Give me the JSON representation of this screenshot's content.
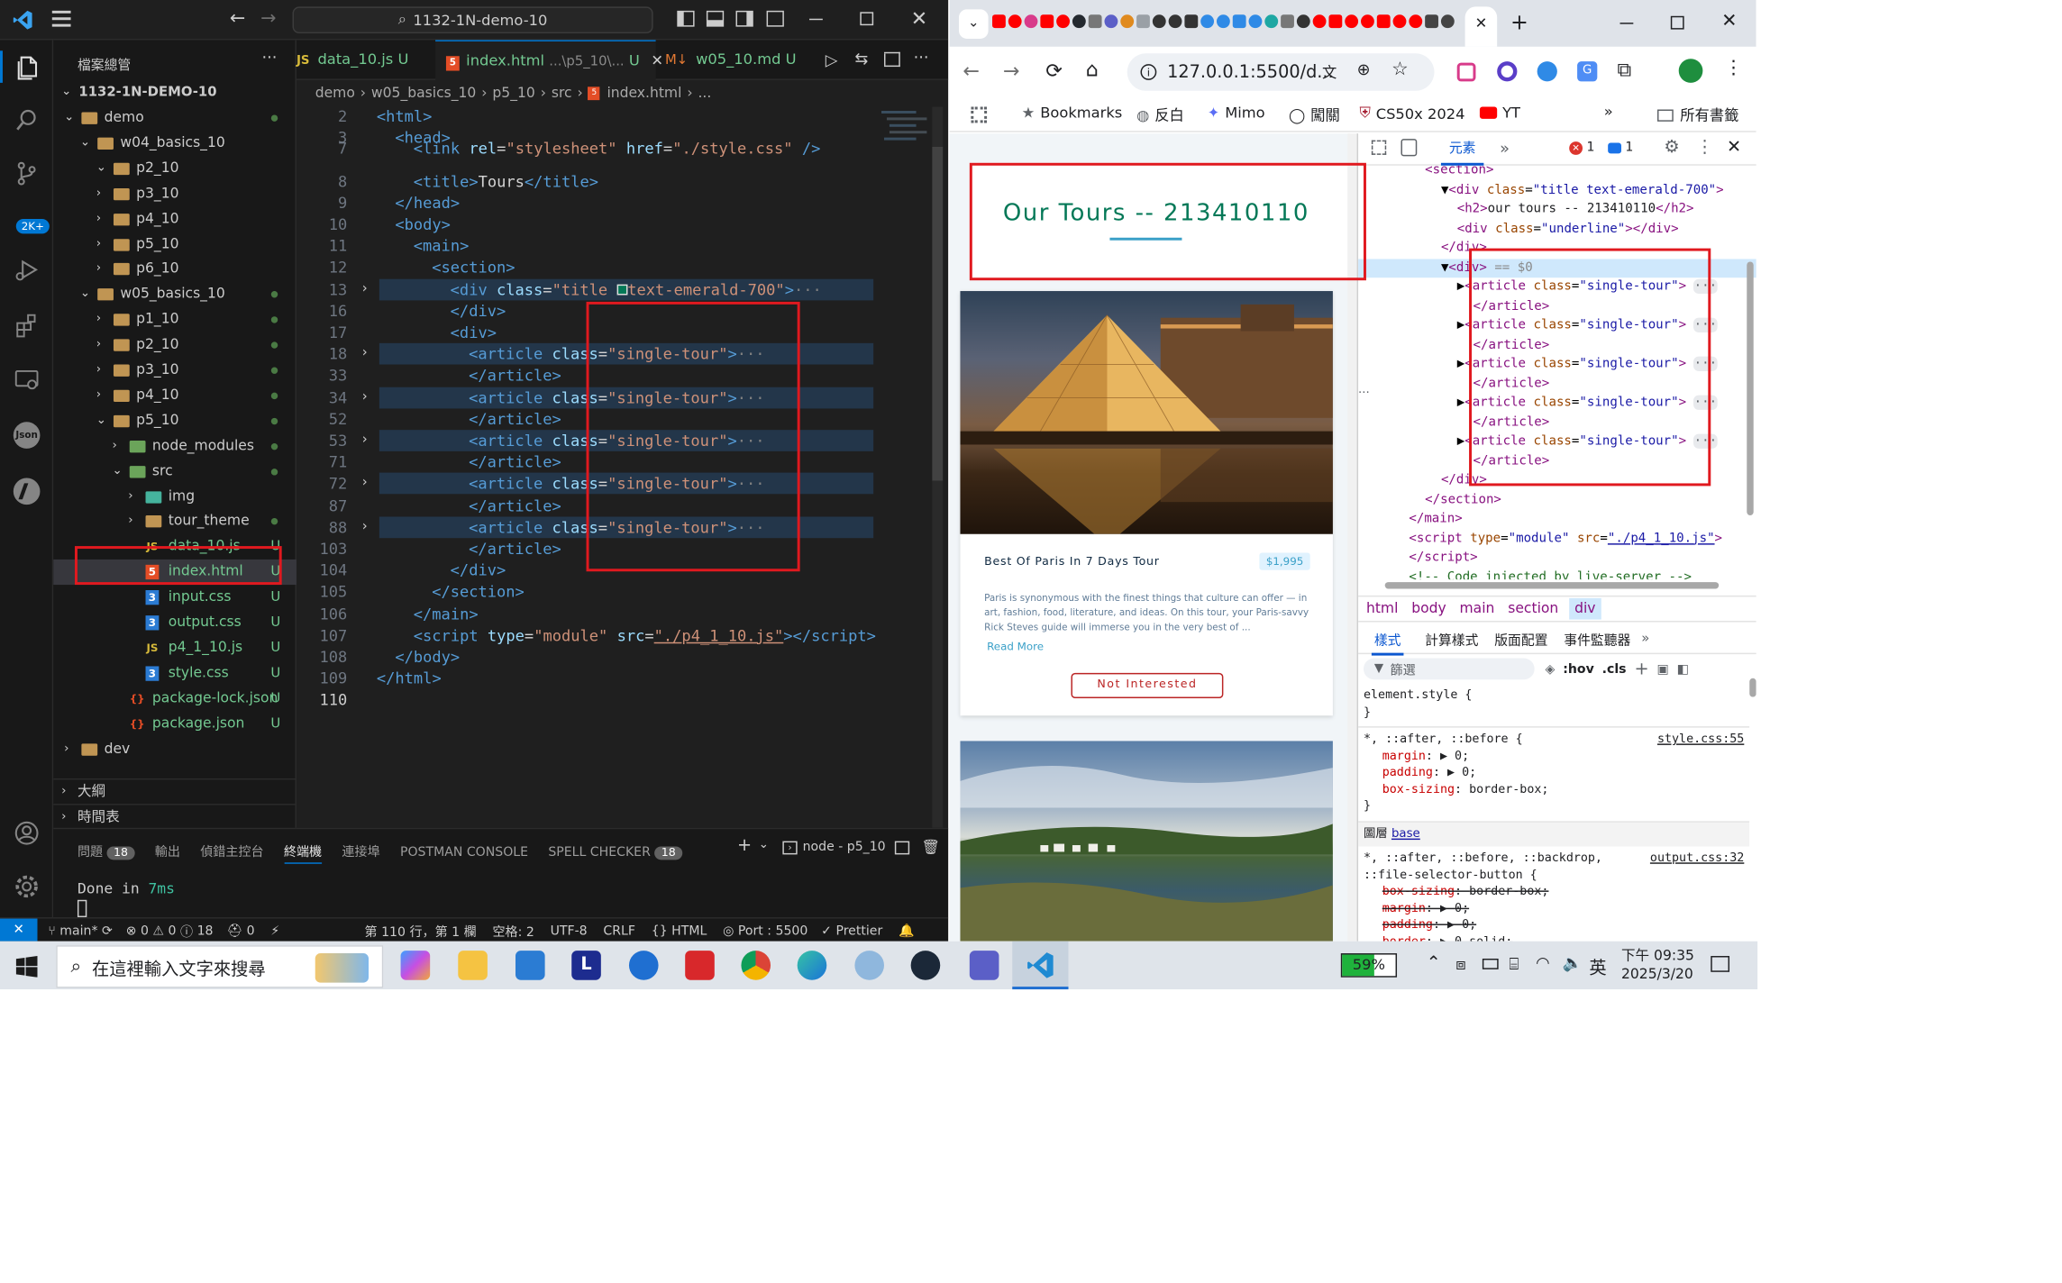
{
  "vscode": {
    "title_search": "1132-1N-demo-10",
    "explorer_title": "檔案總管",
    "root_folder": "1132-1N-DEMO-10",
    "source_control_badge": "2K+",
    "tree": [
      {
        "label": "demo",
        "kind": "folder",
        "open": true,
        "indent": 1,
        "status": "dot"
      },
      {
        "label": "w04_basics_10",
        "kind": "folder",
        "open": true,
        "indent": 2,
        "status": ""
      },
      {
        "label": "p2_10",
        "kind": "folder",
        "open": true,
        "indent": 3,
        "status": ""
      },
      {
        "label": "p3_10",
        "kind": "folder",
        "open": false,
        "indent": 3,
        "status": ""
      },
      {
        "label": "p4_10",
        "kind": "folder",
        "open": false,
        "indent": 3,
        "status": ""
      },
      {
        "label": "p5_10",
        "kind": "folder",
        "open": false,
        "indent": 3,
        "status": ""
      },
      {
        "label": "p6_10",
        "kind": "folder",
        "open": false,
        "indent": 3,
        "status": ""
      },
      {
        "label": "w05_basics_10",
        "kind": "folder",
        "open": true,
        "indent": 2,
        "status": "dot"
      },
      {
        "label": "p1_10",
        "kind": "folder",
        "open": false,
        "indent": 3,
        "status": "dot"
      },
      {
        "label": "p2_10",
        "kind": "folder",
        "open": false,
        "indent": 3,
        "status": "dot"
      },
      {
        "label": "p3_10",
        "kind": "folder",
        "open": false,
        "indent": 3,
        "status": "dot"
      },
      {
        "label": "p4_10",
        "kind": "folder",
        "open": false,
        "indent": 3,
        "status": "dot"
      },
      {
        "label": "p5_10",
        "kind": "folder",
        "open": true,
        "indent": 3,
        "status": "dot"
      },
      {
        "label": "node_modules",
        "kind": "folder-green",
        "open": false,
        "indent": 4,
        "status": "dot"
      },
      {
        "label": "src",
        "kind": "folder-green",
        "open": true,
        "indent": 4,
        "status": "dot"
      },
      {
        "label": "img",
        "kind": "folder-img",
        "open": false,
        "indent": 5,
        "status": ""
      },
      {
        "label": "tour_theme",
        "kind": "folder",
        "open": false,
        "indent": 5,
        "status": "dot"
      },
      {
        "label": "data_10.js",
        "kind": "js",
        "open": false,
        "indent": 5,
        "status": "U"
      },
      {
        "label": "index.html",
        "kind": "html",
        "open": false,
        "indent": 5,
        "status": "U"
      },
      {
        "label": "input.css",
        "kind": "css",
        "open": false,
        "indent": 5,
        "status": "U"
      },
      {
        "label": "output.css",
        "kind": "css",
        "open": false,
        "indent": 5,
        "status": "U"
      },
      {
        "label": "p4_1_10.js",
        "kind": "js",
        "open": false,
        "indent": 5,
        "status": "U"
      },
      {
        "label": "style.css",
        "kind": "css",
        "open": false,
        "indent": 5,
        "status": "U"
      },
      {
        "label": "package-lock.json",
        "kind": "json",
        "open": false,
        "indent": 4,
        "status": "U"
      },
      {
        "label": "package.json",
        "kind": "json",
        "open": false,
        "indent": 4,
        "status": "U"
      },
      {
        "label": "dev",
        "kind": "folder",
        "open": false,
        "indent": 1,
        "status": ""
      }
    ],
    "outline_label": "大綱",
    "timeline_label": "時間表",
    "tabs": [
      {
        "icon": "JS",
        "name": "data_10.js",
        "suffix": "U"
      },
      {
        "icon": "5",
        "name": "index.html",
        "path": "...\\p5_10\\...",
        "suffix": "U",
        "active": true
      },
      {
        "icon": "M",
        "name": "w05_10.md",
        "suffix": "U"
      }
    ],
    "breadcrumb": [
      "demo",
      "w05_basics_10",
      "p5_10",
      "src",
      "index.html",
      "..."
    ],
    "code_lines": [
      {
        "n": "2",
        "html": "<span class='tg'>&lt;html&gt;</span>",
        "ind": 0
      },
      {
        "n": "3",
        "html": "<span class='tg'>&lt;head&gt;</span>",
        "ind": 1
      },
      {
        "n": "7",
        "html": "<span class='tg'>&lt;link</span> <span class='at'>rel</span>=<span class='st'>\"stylesheet\"</span> <span class='at'>href</span>=<span class='st'>\"./style.css\"</span> <span class='tg'>/&gt;</span>",
        "ind": 2
      },
      {
        "n": "8",
        "html": "<span class='tg'>&lt;title&gt;</span>Tours<span class='tg'>&lt;/title&gt;</span>",
        "ind": 2
      },
      {
        "n": "9",
        "html": "<span class='tg'>&lt;/head&gt;</span>",
        "ind": 1
      },
      {
        "n": "10",
        "html": "<span class='tg'>&lt;body&gt;</span>",
        "ind": 1
      },
      {
        "n": "11",
        "html": "<span class='tg'>&lt;main&gt;</span>",
        "ind": 2
      },
      {
        "n": "12",
        "html": "<span class='tg'>&lt;section&gt;</span>",
        "ind": 3
      },
      {
        "n": "13",
        "html": "<span class='tg'>&lt;div</span> <span class='at'>class</span>=<span class='st'>\"title </span><span style='display:inline-block;width:8px;height:8px;background:#047857;border:1px solid #ddd'></span><span class='st'>text-emerald-700\"</span><span class='tg'>&gt;</span><span class='gy'>···</span>",
        "ind": 4,
        "fold": true,
        "hl": true
      },
      {
        "n": "16",
        "html": "<span class='tg'>&lt;/div&gt;</span>",
        "ind": 4
      },
      {
        "n": "17",
        "html": "<span class='tg'>&lt;div&gt;</span>",
        "ind": 4
      },
      {
        "n": "18",
        "html": "<span class='tg'>&lt;article</span> <span class='at'>class</span>=<span class='st'>\"single-tour\"</span><span class='tg'>&gt;</span><span class='gy'>···</span>",
        "ind": 5,
        "fold": true,
        "hl": true
      },
      {
        "n": "33",
        "html": "<span class='tg'>&lt;/article&gt;</span>",
        "ind": 5
      },
      {
        "n": "34",
        "html": "<span class='tg'>&lt;article</span> <span class='at'>class</span>=<span class='st'>\"single-tour\"</span><span class='tg'>&gt;</span><span class='gy'>···</span>",
        "ind": 5,
        "fold": true,
        "hl": true
      },
      {
        "n": "52",
        "html": "<span class='tg'>&lt;/article&gt;</span>",
        "ind": 5
      },
      {
        "n": "53",
        "html": "<span class='tg'>&lt;article</span> <span class='at'>class</span>=<span class='st'>\"single-tour\"</span><span class='tg'>&gt;</span><span class='gy'>···</span>",
        "ind": 5,
        "fold": true,
        "hl": true
      },
      {
        "n": "71",
        "html": "<span class='tg'>&lt;/article&gt;</span>",
        "ind": 5
      },
      {
        "n": "72",
        "html": "<span class='tg'>&lt;article</span> <span class='at'>class</span>=<span class='st'>\"single-tour\"</span><span class='tg'>&gt;</span><span class='gy'>···</span>",
        "ind": 5,
        "fold": true,
        "hl": true
      },
      {
        "n": "87",
        "html": "<span class='tg'>&lt;/article&gt;</span>",
        "ind": 5
      },
      {
        "n": "88",
        "html": "<span class='tg'>&lt;article</span> <span class='at'>class</span>=<span class='st'>\"single-tour\"</span><span class='tg'>&gt;</span><span class='gy'>···</span>",
        "ind": 5,
        "fold": true,
        "hl": true
      },
      {
        "n": "103",
        "html": "<span class='tg'>&lt;/article&gt;</span>",
        "ind": 5
      },
      {
        "n": "104",
        "html": "<span class='tg'>&lt;/div&gt;</span>",
        "ind": 4
      },
      {
        "n": "105",
        "html": "<span class='tg'>&lt;/section&gt;</span>",
        "ind": 3
      },
      {
        "n": "106",
        "html": "<span class='tg'>&lt;/main&gt;</span>",
        "ind": 2
      },
      {
        "n": "107",
        "html": "<span class='tg'>&lt;script</span> <span class='at'>type</span>=<span class='st'>\"module\"</span> <span class='at'>src</span>=<span class='st' style='text-decoration:underline'>\"./p4_1_10.js\"</span><span class='tg'>&gt;&lt;/script&gt;</span>",
        "ind": 2
      },
      {
        "n": "108",
        "html": "<span class='tg'>&lt;/body&gt;</span>",
        "ind": 1
      },
      {
        "n": "109",
        "html": "<span class='tg'>&lt;/html&gt;</span>",
        "ind": 0
      },
      {
        "n": "110",
        "html": "",
        "ind": 0
      }
    ],
    "panel_tabs": [
      {
        "label": "問題",
        "badge": "18"
      },
      {
        "label": "輸出"
      },
      {
        "label": "偵錯主控台"
      },
      {
        "label": "終端機",
        "active": true
      },
      {
        "label": "連接埠"
      },
      {
        "label": "POSTMAN CONSOLE"
      },
      {
        "label": "SPELL CHECKER",
        "badge": "18"
      }
    ],
    "terminal_name": "node - p5_10",
    "terminal_output_prefix": "Done in ",
    "terminal_output_time": "7ms",
    "status": {
      "branch": "main*",
      "errors": "0",
      "warnings": "0",
      "info": "18",
      "ports": "0",
      "position": "第 110 行，第 1 欄",
      "spaces": "空格: 2",
      "encoding": "UTF-8",
      "eol": "CRLF",
      "language": "HTML",
      "port": "Port : 5500",
      "prettier": "Prettier"
    }
  },
  "chrome": {
    "url": "127.0.0.1:5500/d...",
    "bookmarks": [
      "Bookmarks",
      "反白",
      "Mimo",
      "闖關",
      "CS50x 2024",
      "YT"
    ],
    "all_bookmarks": "所有書籤",
    "page": {
      "heading": "Our Tours -- 213410110",
      "card": {
        "name": "Best Of Paris In 7 Days Tour",
        "price": "$1,995",
        "info": "Paris is synonymous with the finest things that culture can offer — in art, fashion, food, literature, and ideas. On this tour, your Paris-savvy Rick Steves guide will immerse you in the very best of ...",
        "read_more": "Read More",
        "button": "Not Interested"
      }
    },
    "devtools": {
      "tab_elements": "元素",
      "errors": "1",
      "messages": "1",
      "dom_lines": [
        {
          "ind": 0,
          "html": "<span class='t'>&lt;section&gt;</span>"
        },
        {
          "ind": 1,
          "html": "▼<span class='t'>&lt;div</span> <span class='a'>class</span>=<span class='v'>\"title text-emerald-700\"</span><span class='t'>&gt;</span>"
        },
        {
          "ind": 2,
          "html": "<span class='t'>&lt;h2&gt;</span><span class='x'>our tours -- 213410110</span><span class='t'>&lt;/h2&gt;</span>"
        },
        {
          "ind": 2,
          "html": "<span class='t'>&lt;div</span> <span class='a'>class</span>=<span class='v'>\"underline\"</span><span class='t'>&gt;&lt;/div&gt;</span>"
        },
        {
          "ind": 1,
          "html": "<span class='t'>&lt;/div&gt;</span>"
        },
        {
          "ind": 1,
          "html": "▼<span class='t'>&lt;div&gt;</span> <span style='color:#888'>== $0</span>",
          "sel": true
        },
        {
          "ind": 2,
          "html": "▶<span class='t'>&lt;article</span> <span class='a'>class</span>=<span class='v'>\"single-tour\"</span><span class='t'>&gt;</span> <span style='background:#e8eaed;color:#5f6368;border-radius:4px'>···</span>"
        },
        {
          "ind": 3,
          "html": "<span class='t'>&lt;/article&gt;</span>"
        },
        {
          "ind": 2,
          "html": "▶<span class='t'>&lt;article</span> <span class='a'>class</span>=<span class='v'>\"single-tour\"</span><span class='t'>&gt;</span> <span style='background:#e8eaed;color:#5f6368;border-radius:4px'>···</span>"
        },
        {
          "ind": 3,
          "html": "<span class='t'>&lt;/article&gt;</span>"
        },
        {
          "ind": 2,
          "html": "▶<span class='t'>&lt;article</span> <span class='a'>class</span>=<span class='v'>\"single-tour\"</span><span class='t'>&gt;</span> <span style='background:#e8eaed;color:#5f6368;border-radius:4px'>···</span>"
        },
        {
          "ind": 3,
          "html": "<span class='t'>&lt;/article&gt;</span>"
        },
        {
          "ind": 2,
          "html": "▶<span class='t'>&lt;article</span> <span class='a'>class</span>=<span class='v'>\"single-tour\"</span><span class='t'>&gt;</span> <span style='background:#e8eaed;color:#5f6368;border-radius:4px'>···</span>"
        },
        {
          "ind": 3,
          "html": "<span class='t'>&lt;/article&gt;</span>"
        },
        {
          "ind": 2,
          "html": "▶<span class='t'>&lt;article</span> <span class='a'>class</span>=<span class='v'>\"single-tour\"</span><span class='t'>&gt;</span> <span style='background:#e8eaed;color:#5f6368;border-radius:4px'>···</span>"
        },
        {
          "ind": 3,
          "html": "<span class='t'>&lt;/article&gt;</span>"
        },
        {
          "ind": 1,
          "html": "<span class='t'>&lt;/div&gt;</span>"
        },
        {
          "ind": 0,
          "html": "<span class='t'>&lt;/section&gt;</span>"
        },
        {
          "ind": -1,
          "html": "<span class='t'>&lt;/main&gt;</span>"
        },
        {
          "ind": -1,
          "html": "<span class='t'>&lt;script</span> <span class='a'>type</span>=<span class='v'>\"module\"</span> <span class='a'>src</span>=<span class='v' style='text-decoration:underline'>\"./p4_1_10.js\"</span><span class='t'>&gt;</span>"
        },
        {
          "ind": -1,
          "html": "<span class='t'>&lt;/script&gt;</span>"
        },
        {
          "ind": -1,
          "html": "<span style='color:#236e25'>&lt;!-- Code injected by live-server --&gt;</span>"
        }
      ],
      "crumbs": [
        "html",
        "body",
        "main",
        "section",
        "div"
      ],
      "style_tabs": [
        "樣式",
        "計算樣式",
        "版面配置",
        "事件監聽器"
      ],
      "filter_placeholder": "篩選",
      "hov": ":hov",
      "cls": ".cls",
      "element_style": "element.style {",
      "rule1_selector": "*, ::after, ::before {",
      "rule1_source": "style.css:55",
      "rule1_props": [
        {
          "name": "margin",
          "value": "0"
        },
        {
          "name": "padding",
          "value": "0"
        },
        {
          "name": "box-sizing",
          "value": "border-box"
        }
      ],
      "layer_label": "圖層",
      "layer_link": "base",
      "rule2_selector": "*, ::after, ::before, ::backdrop,",
      "rule2_selector2": "::file-selector-button {",
      "rule2_source": "output.css:32",
      "rule2_props": [
        {
          "name": "box-sizing",
          "value": "border-box"
        },
        {
          "name": "margin",
          "value": "0"
        },
        {
          "name": "padding",
          "value": "0"
        },
        {
          "name": "border",
          "value": "0 solid"
        }
      ]
    }
  },
  "taskbar": {
    "search_placeholder": "在這裡輸入文字來搜尋",
    "battery": "59%",
    "ime": "英",
    "time": "下午 09:35",
    "date": "2025/3/20"
  }
}
